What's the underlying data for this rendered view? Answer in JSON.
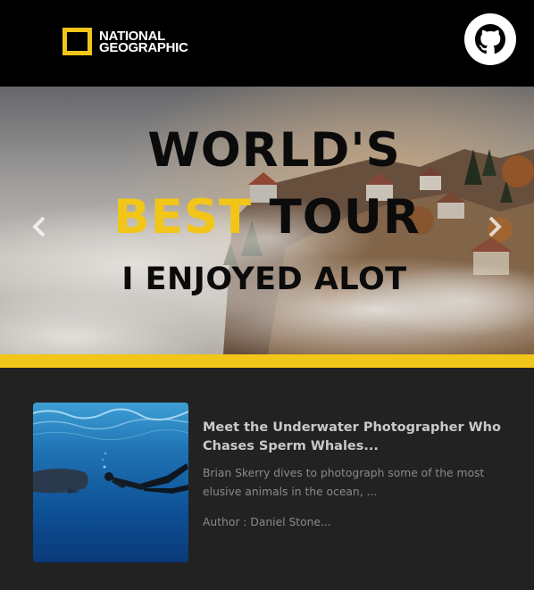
{
  "header": {
    "logo_line1": "NATIONAL",
    "logo_line2": "GEOGRAPHIC",
    "logo_icon": "natgeo-yellow-frame",
    "github_icon": "github-icon"
  },
  "hero": {
    "title_line1": "WORLD'S",
    "title_line2_highlight": "BEST",
    "title_line2_rest": " TOUR",
    "title_line3": "I ENJOYED ALOT",
    "prev_icon": "chevron-left-icon",
    "next_icon": "chevron-right-icon"
  },
  "article": {
    "title": "Meet the Underwater Photographer Who Chases Sperm Whales...",
    "description": "Brian Skerry dives to photograph some of the most elusive animals in the ocean, ...",
    "author": "Author : Daniel Stone..."
  },
  "colors": {
    "accent": "#f2c519",
    "header_bg": "#000000",
    "page_bg": "#222222"
  }
}
